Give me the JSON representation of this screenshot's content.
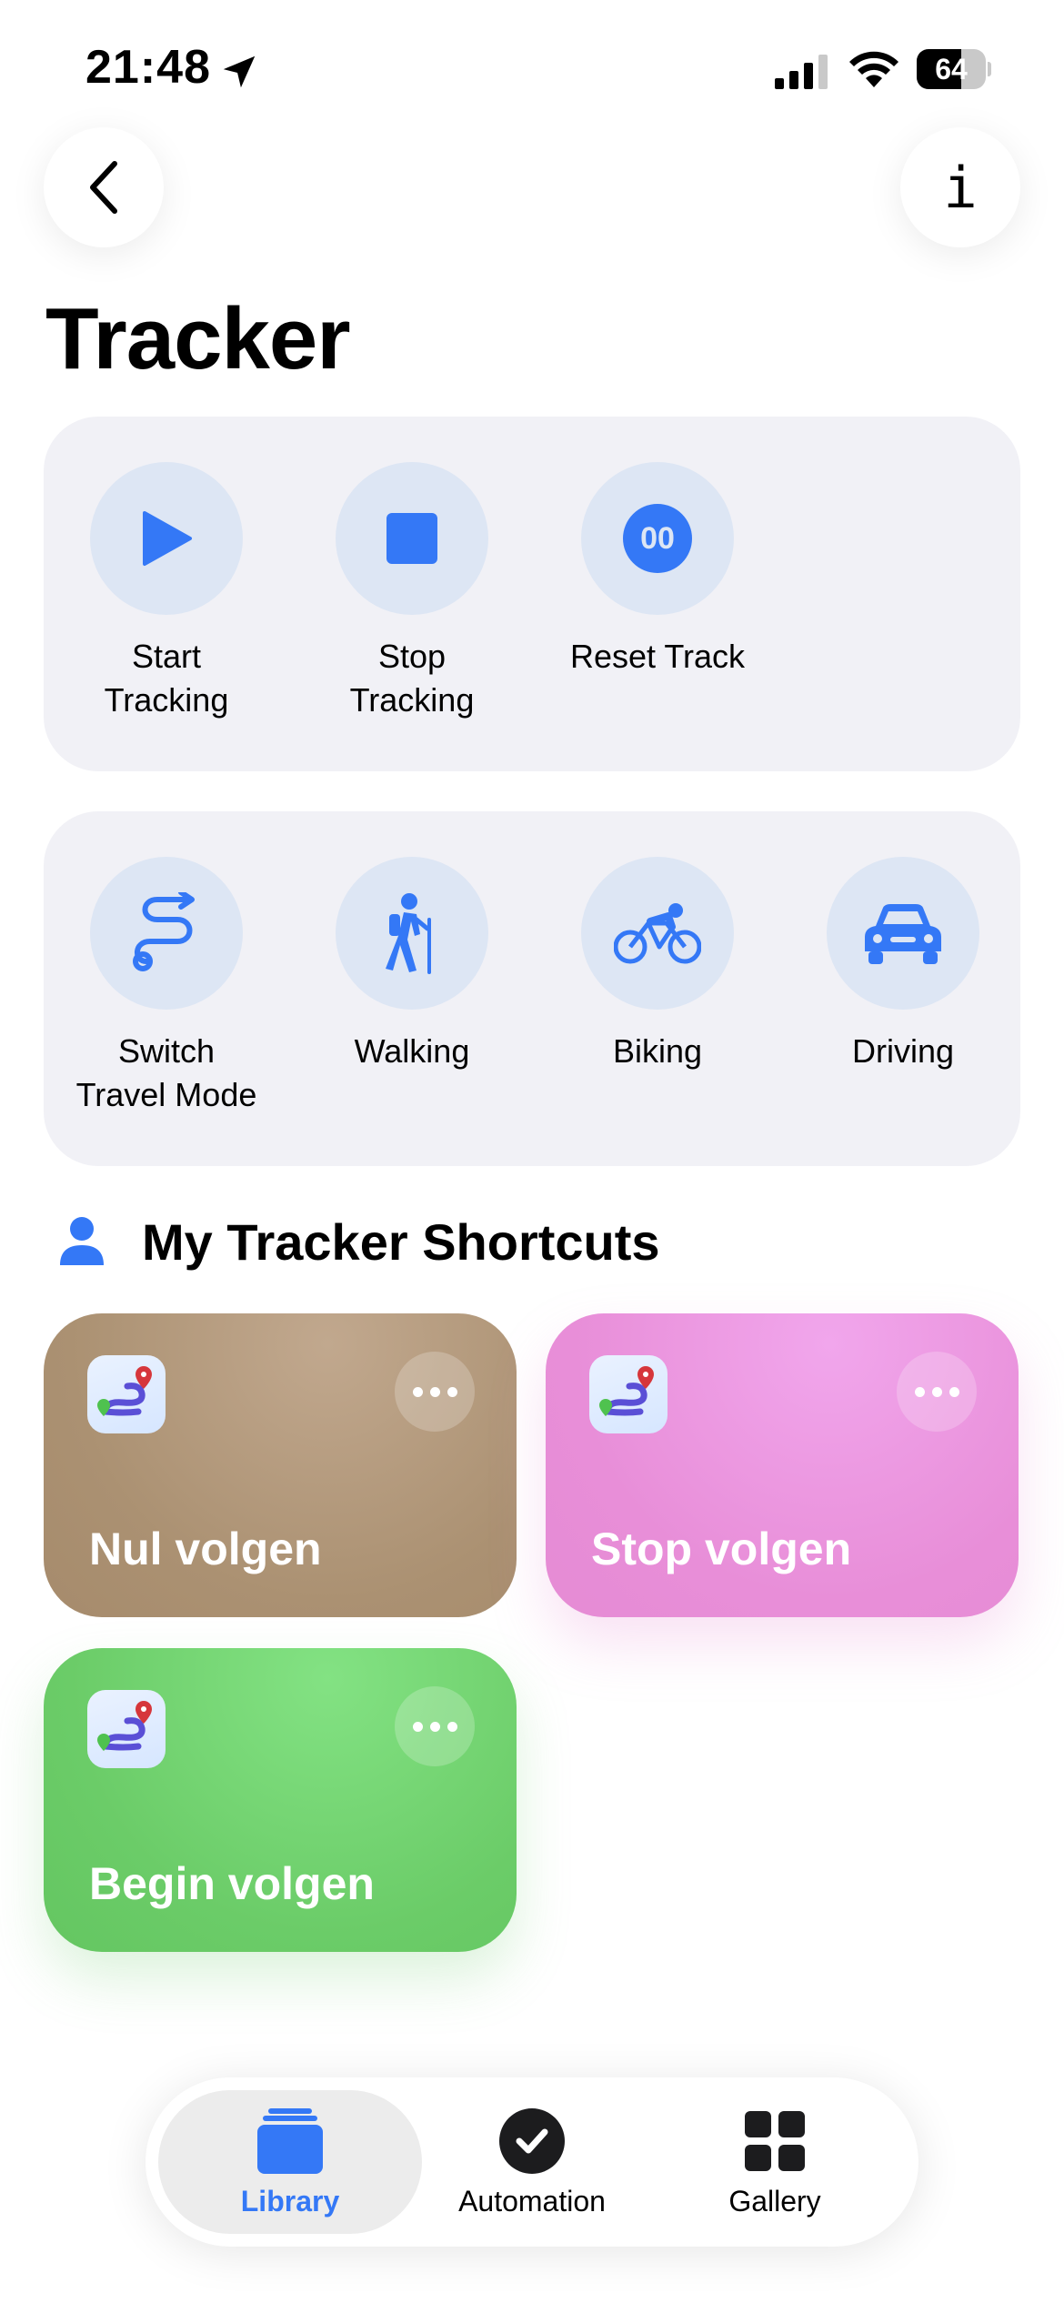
{
  "status_bar": {
    "time": "21:48",
    "battery_percent": 64
  },
  "header": {
    "title": "Tracker"
  },
  "colors": {
    "accent": "#3478f6",
    "panel": "#f1f1f6",
    "circle": "#dde6f4",
    "brown": "#ab9172",
    "pink": "#e88ed8",
    "green": "#6bcc68"
  },
  "actions_primary": [
    {
      "label_line1": "Start",
      "label_line2": "Tracking",
      "icon": "play-icon"
    },
    {
      "label_line1": "Stop",
      "label_line2": "Tracking",
      "icon": "stop-icon"
    },
    {
      "label_line1": "Reset Track",
      "label_line2": "",
      "icon": "reset-00-icon",
      "glyph": "00"
    }
  ],
  "actions_modes": [
    {
      "label_line1": "Switch",
      "label_line2": "Travel Mode",
      "icon": "route-icon"
    },
    {
      "label_line1": "Walking",
      "label_line2": "",
      "icon": "hiker-icon"
    },
    {
      "label_line1": "Biking",
      "label_line2": "",
      "icon": "bicycle-icon"
    },
    {
      "label_line1": "Driving",
      "label_line2": "",
      "icon": "car-icon"
    }
  ],
  "section": {
    "title": "My Tracker Shortcuts"
  },
  "shortcuts": [
    {
      "name": "Nul volgen",
      "color": "brown"
    },
    {
      "name": "Stop volgen",
      "color": "pink"
    },
    {
      "name": "Begin volgen",
      "color": "green"
    }
  ],
  "tabbar": {
    "library": "Library",
    "automation": "Automation",
    "gallery": "Gallery",
    "selected": "Library"
  }
}
